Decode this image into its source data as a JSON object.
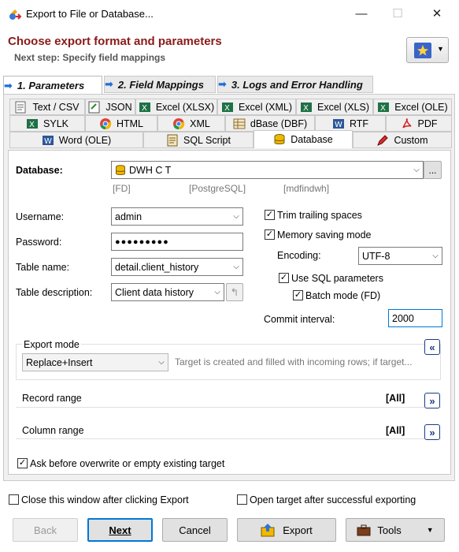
{
  "window": {
    "title": "Export to File or Database...",
    "minimize": "—",
    "maximize": "☐",
    "close": "✕"
  },
  "header": {
    "title": "Choose export format and parameters",
    "subtitle": "Next step: Specify field mappings"
  },
  "steps": [
    {
      "label": "1. Parameters"
    },
    {
      "label": "2. Field Mappings"
    },
    {
      "label": "3. Logs and Error Handling"
    }
  ],
  "formats": {
    "row1": [
      "Text / CSV",
      "JSON",
      "Excel (XLSX)",
      "Excel (XML)",
      "Excel (XLS)",
      "Excel (OLE)"
    ],
    "row2": [
      "SYLK",
      "HTML",
      "XML",
      "dBase (DBF)",
      "RTF",
      "PDF"
    ],
    "row3": [
      "Word (OLE)",
      "SQL Script",
      "Database",
      "Custom"
    ]
  },
  "database": {
    "label": "Database:",
    "value": "DWH C T",
    "hints": [
      "[FD]",
      "[PostgreSQL]",
      "[mdfindwh]"
    ],
    "more": "..."
  },
  "username": {
    "label": "Username:",
    "value": "admin"
  },
  "password": {
    "label": "Password:",
    "value": "●●●●●●●●●"
  },
  "table_name": {
    "label": "Table name:",
    "value": "detail.client_history"
  },
  "table_description": {
    "label": "Table description:",
    "value": "Client data history"
  },
  "options": {
    "trim_trailing_spaces": {
      "label": "Trim trailing spaces",
      "checked": true
    },
    "memory_saving_mode": {
      "label": "Memory saving mode",
      "checked": true
    },
    "encoding": {
      "label": "Encoding:",
      "value": "UTF-8"
    },
    "use_sql_parameters": {
      "label": "Use SQL parameters",
      "checked": true
    },
    "batch_mode": {
      "label": "Batch mode (FD)",
      "checked": true
    },
    "commit_interval": {
      "label": "Commit interval:",
      "value": "2000"
    }
  },
  "export_mode": {
    "label": "Export mode",
    "value": "Replace+Insert",
    "description": "Target is created and filled with incoming rows; if target..."
  },
  "record_range": {
    "label": "Record range",
    "value": "[All]"
  },
  "column_range": {
    "label": "Column range",
    "value": "[All]"
  },
  "ask_before_overwrite": {
    "label": "Ask before overwrite or empty existing target",
    "checked": true
  },
  "footer": {
    "close_after_export": {
      "label": "Close this window after clicking Export",
      "checked": false
    },
    "open_target": {
      "label": "Open target after successful exporting",
      "checked": false
    },
    "buttons": {
      "back": "Back",
      "next": "Next",
      "cancel": "Cancel",
      "export": "Export",
      "tools": "Tools"
    }
  },
  "colors": {
    "accent": "#0078d7",
    "header_title": "#8b1a1a",
    "step_arrow": "#1e6fd9"
  }
}
